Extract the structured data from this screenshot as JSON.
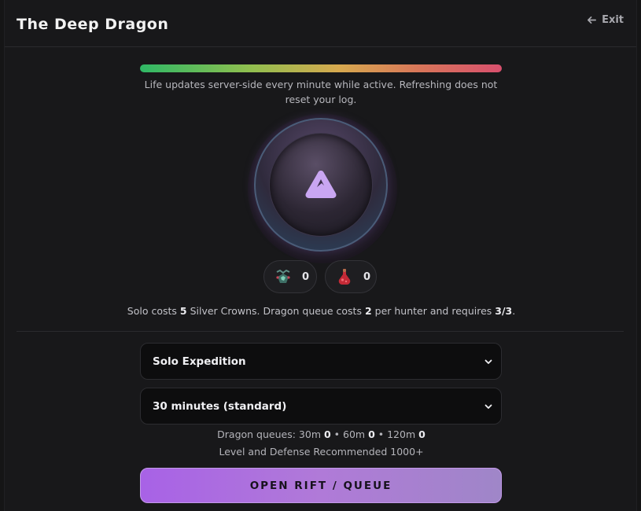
{
  "header": {
    "title": "The Deep Dragon",
    "exit_label": "Exit"
  },
  "life": {
    "level": 1.0,
    "note": "Life updates server-side every minute while active. Refreshing does not reset your log."
  },
  "orb": {
    "icon": "mountain-peak-icon"
  },
  "items": [
    {
      "icon": "emerald-amulet-icon",
      "count": "0"
    },
    {
      "icon": "red-potion-icon",
      "count": "0"
    }
  ],
  "costs": {
    "p1": "Solo costs ",
    "solo_cost": "5",
    "p2": " Silver Crowns. Dragon queue costs ",
    "queue_cost": "2",
    "p3": " per hunter and requires ",
    "requirement": "3/3",
    "p4": "."
  },
  "mode_select": {
    "value": "Solo Expedition"
  },
  "duration_select": {
    "value": "30 minutes (standard)"
  },
  "queues": {
    "label": "Dragon queues: ",
    "q30_label": "30m ",
    "q30": "0",
    "q60_label": "60m ",
    "q60": "0",
    "q120_label": "120m ",
    "q120": "0",
    "sep": " • "
  },
  "recommendation": "Level and Defense Recommended 1000+",
  "cta_label": "OPEN RIFT / QUEUE",
  "colors": {
    "accent": "#a862e6",
    "background": "#18181a",
    "icon_purple": "#c9a6f2"
  }
}
